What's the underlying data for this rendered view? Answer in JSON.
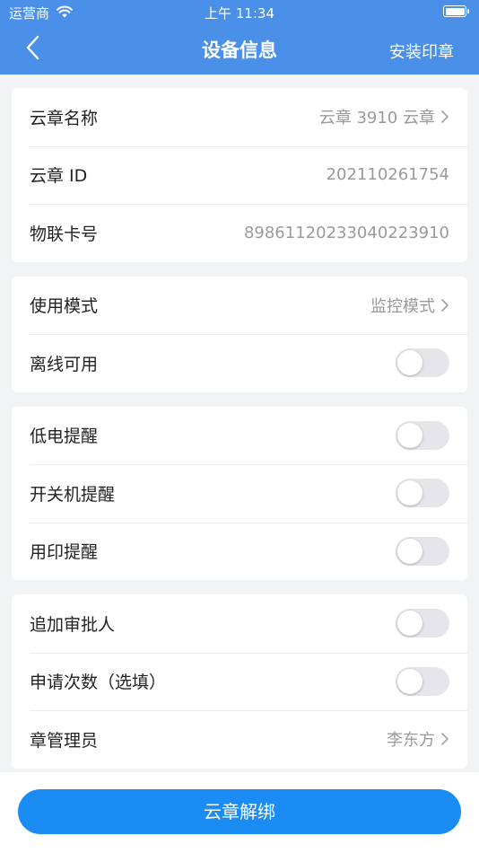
{
  "status_bar": {
    "carrier": "运营商",
    "time": "上午 11:34"
  },
  "nav": {
    "title": "设备信息",
    "action_label": "安装印章"
  },
  "sections": [
    [
      {
        "label": "云章名称",
        "value": "云章 3910 云章",
        "chevron": true
      },
      {
        "label": "云章 ID",
        "value": "202110261754",
        "chevron": false
      },
      {
        "label": "物联卡号",
        "value": "89861120233040223910",
        "chevron": false
      }
    ],
    [
      {
        "label": "使用模式",
        "value": "监控模式",
        "chevron": true
      },
      {
        "label": "离线可用",
        "toggle": false
      }
    ],
    [
      {
        "label": "低电提醒",
        "toggle": false
      },
      {
        "label": "开关机提醒",
        "toggle": false
      },
      {
        "label": "用印提醒",
        "toggle": false
      }
    ],
    [
      {
        "label": "追加审批人",
        "toggle": false
      },
      {
        "label": "申请次数（选填）",
        "toggle": false
      },
      {
        "label": "章管理员",
        "value": "李东方",
        "chevron": true
      }
    ]
  ],
  "footer": {
    "unbind_label": "云章解绑"
  },
  "colors": {
    "header_bg": "#4a90e8",
    "button_bg": "#1a8cf3",
    "toggle_off": "#e6e6ea"
  }
}
